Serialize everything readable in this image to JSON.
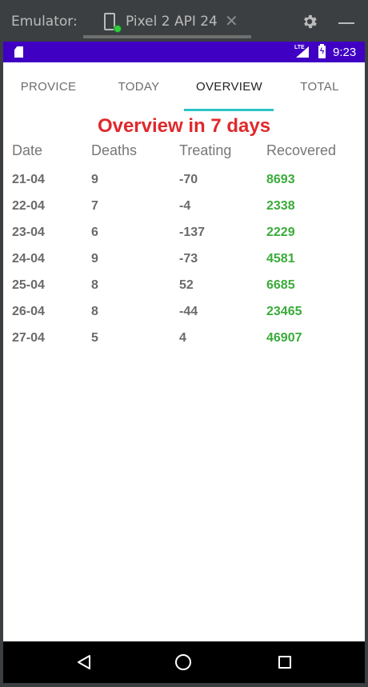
{
  "emulator": {
    "label": "Emulator:",
    "device_name": "Pixel 2 API 24",
    "close_glyph": "✕"
  },
  "status_bar": {
    "time": "9:23",
    "network": "LTE",
    "color": "#3f00c3"
  },
  "tabs": [
    {
      "label": "PROVICE"
    },
    {
      "label": "TODAY"
    },
    {
      "label": "OVERVIEW",
      "active": true
    },
    {
      "label": "TOTAL"
    }
  ],
  "title": "Overview in 7 days",
  "table": {
    "headers": [
      "Date",
      "Deaths",
      "Treating",
      "Recovered"
    ],
    "rows": [
      [
        "21-04",
        "9",
        "-70",
        "8693"
      ],
      [
        "22-04",
        "7",
        "-4",
        "2338"
      ],
      [
        "23-04",
        "6",
        "-137",
        "2229"
      ],
      [
        "24-04",
        "9",
        "-73",
        "4581"
      ],
      [
        "25-04",
        "8",
        "52",
        "6685"
      ],
      [
        "26-04",
        "8",
        "-44",
        "23465"
      ],
      [
        "27-04",
        "5",
        "4",
        "46907"
      ]
    ]
  },
  "colors": {
    "title": "#e0292c",
    "recovered": "#3aab3a",
    "tab_indicator": "#29c5c5"
  }
}
